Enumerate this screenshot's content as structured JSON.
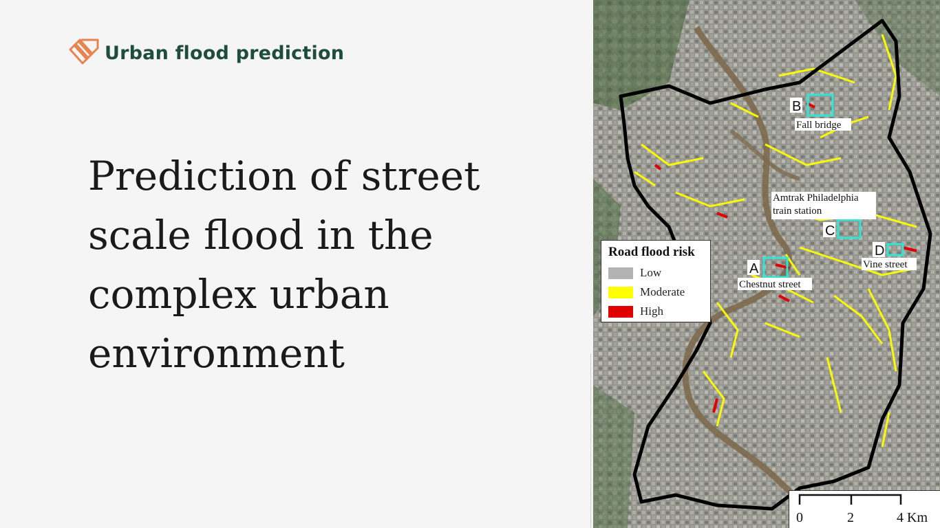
{
  "header": {
    "title": "Urban flood prediction",
    "logo_icon": "layered-chevrons-logo-icon",
    "logo_color": "#e8834f"
  },
  "main": {
    "headline_lines": [
      "Prediction of street",
      "scale flood in the",
      "complex urban",
      "environment"
    ]
  },
  "map": {
    "legend": {
      "title": "Road flood risk",
      "items": [
        {
          "label": "Low",
          "color": "#b3b3b3"
        },
        {
          "label": "Moderate",
          "color": "#ffff00"
        },
        {
          "label": "High",
          "color": "#e00000"
        }
      ]
    },
    "sites": [
      {
        "letter": "A",
        "name": "Chestnut street"
      },
      {
        "letter": "B",
        "name": "Fall bridge"
      },
      {
        "letter": "C",
        "name": "Amtrak Philadelphia train station"
      },
      {
        "letter": "D",
        "name": "Vine street"
      }
    ],
    "site_box_color": "#2ee6d6",
    "boundary_color": "#000000",
    "scale": {
      "ticks": [
        "0",
        "2",
        "4 Km"
      ]
    }
  }
}
